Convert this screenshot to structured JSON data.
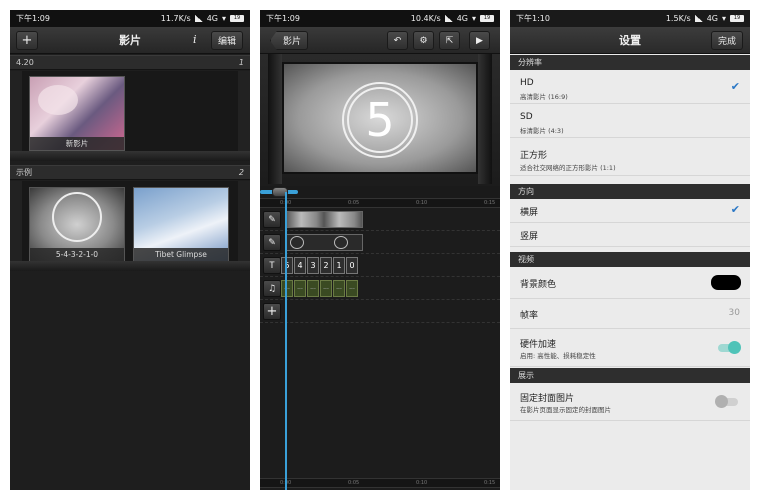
{
  "status": {
    "p1": {
      "time": "下午1:09",
      "speed": "11.7K/s",
      "net": "4G",
      "battery": "19"
    },
    "p2": {
      "time": "下午1:09",
      "speed": "10.4K/s",
      "net": "4G",
      "battery": "19"
    },
    "p3": {
      "time": "下午1:10",
      "speed": "1.5K/s",
      "net": "4G",
      "battery": "19"
    }
  },
  "movies": {
    "add_label": "+",
    "title": "影片",
    "info_label": "i",
    "edit_label": "编辑",
    "sections": [
      {
        "name": "4.20",
        "count": "1",
        "items": [
          {
            "label": "新影片"
          }
        ]
      },
      {
        "name": "示例",
        "count": "2",
        "items": [
          {
            "label": "5-4-3-2-1-0"
          },
          {
            "label": "Tibet Glimpse"
          }
        ]
      }
    ]
  },
  "editor": {
    "back_label": "影片",
    "countdown_number": "5",
    "ruler_ticks": [
      "0:00",
      "0:05",
      "0:10",
      "0:15"
    ],
    "text_clips": [
      "5",
      "4",
      "3",
      "2",
      "1",
      "0"
    ],
    "audio_clips": [
      "...",
      "...",
      "...",
      "...",
      "...",
      "..."
    ],
    "track_icons": {
      "video": "✎",
      "transition": "✎",
      "text": "T",
      "audio": "♫",
      "add": "+"
    }
  },
  "settings": {
    "title": "设置",
    "done_label": "完成",
    "sections": {
      "resolution": "分辨率",
      "orientation": "方向",
      "video": "视频",
      "display": "展示"
    },
    "resolution": [
      {
        "label": "HD",
        "sub": "高清影片 (16:9)",
        "checked": true
      },
      {
        "label": "SD",
        "sub": "标清影片 (4:3)",
        "checked": false
      },
      {
        "label": "正方形",
        "sub": "适合社交网络的正方形影片 (1:1)",
        "checked": false
      }
    ],
    "orientation": [
      {
        "label": "横屏",
        "checked": true
      },
      {
        "label": "竖屏",
        "checked": false
      }
    ],
    "video": {
      "bg_color_label": "背景颜色",
      "bg_color": "#000000",
      "fps_label": "帧率",
      "fps_value": "30",
      "hw_label": "硬件加速",
      "hw_sub": "启用: 高性能、损耗稳定性",
      "hw_on": true
    },
    "display": {
      "cover_label": "固定封面图片",
      "cover_sub": "在影片页面显示固定的封面图片",
      "cover_on": false
    },
    "colors": {
      "accent": "#2b78c6",
      "toggle_on": "#4fc3b8"
    }
  }
}
